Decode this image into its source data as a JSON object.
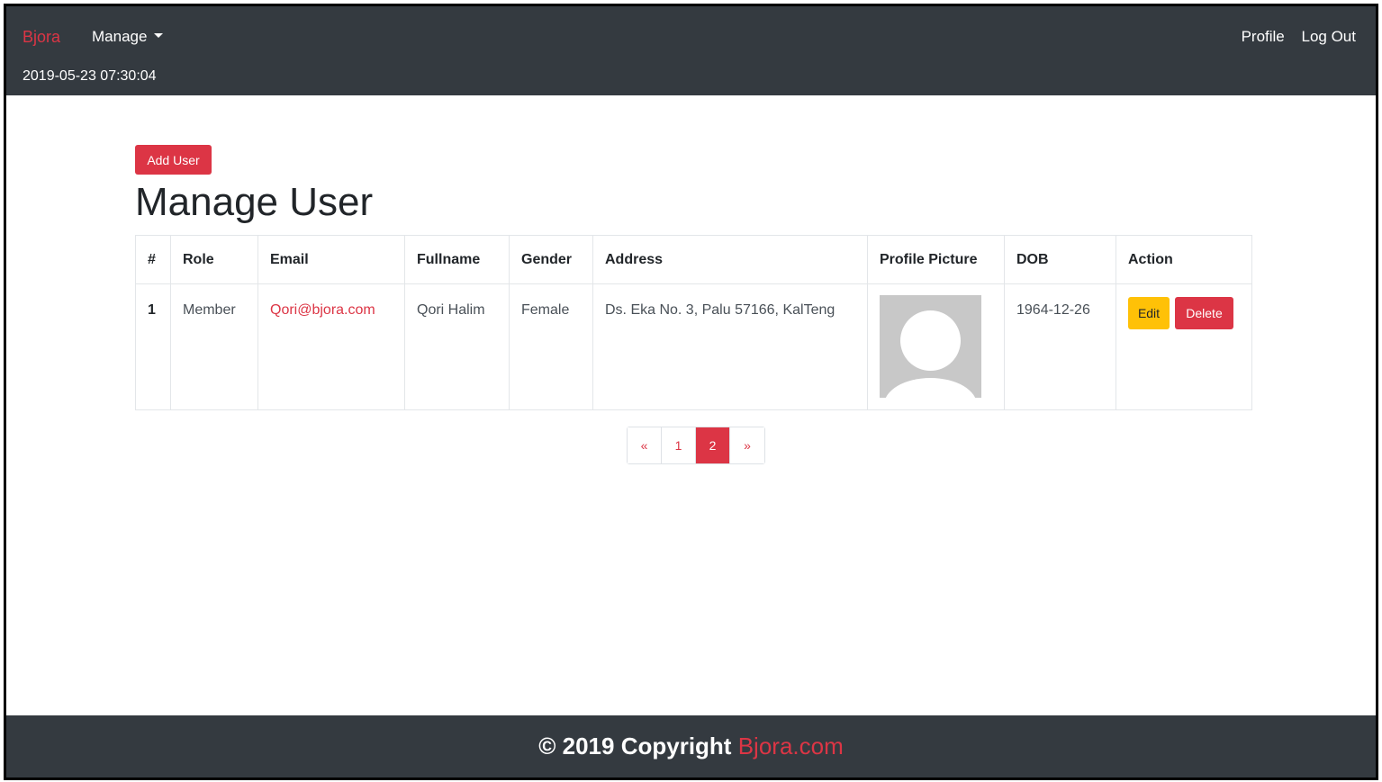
{
  "navbar": {
    "brand": "Bjora",
    "manage_label": "Manage",
    "datetime": "2019-05-23 07:30:04",
    "profile_label": "Profile",
    "logout_label": "Log Out"
  },
  "main": {
    "add_user_label": "Add User",
    "title": "Manage User",
    "table": {
      "headers": [
        "#",
        "Role",
        "Email",
        "Fullname",
        "Gender",
        "Address",
        "Profile Picture",
        "DOB",
        "Action"
      ],
      "rows": [
        {
          "num": "1",
          "role": "Member",
          "email": "Qori@bjora.com",
          "fullname": "Qori Halim",
          "gender": "Female",
          "address": "Ds. Eka No. 3, Palu 57166, KalTeng",
          "profile_picture": "avatar-placeholder",
          "dob": "1964-12-26",
          "edit_label": "Edit",
          "delete_label": "Delete"
        }
      ]
    },
    "pagination": {
      "prev": "«",
      "pages": [
        "1",
        "2"
      ],
      "active_page": "2",
      "next": "»"
    }
  },
  "footer": {
    "copyright": "© 2019 Copyright",
    "site": "Bjora.com"
  },
  "colors": {
    "navbar_bg": "#343a40",
    "accent": "#dc3545",
    "warning": "#ffc107"
  }
}
